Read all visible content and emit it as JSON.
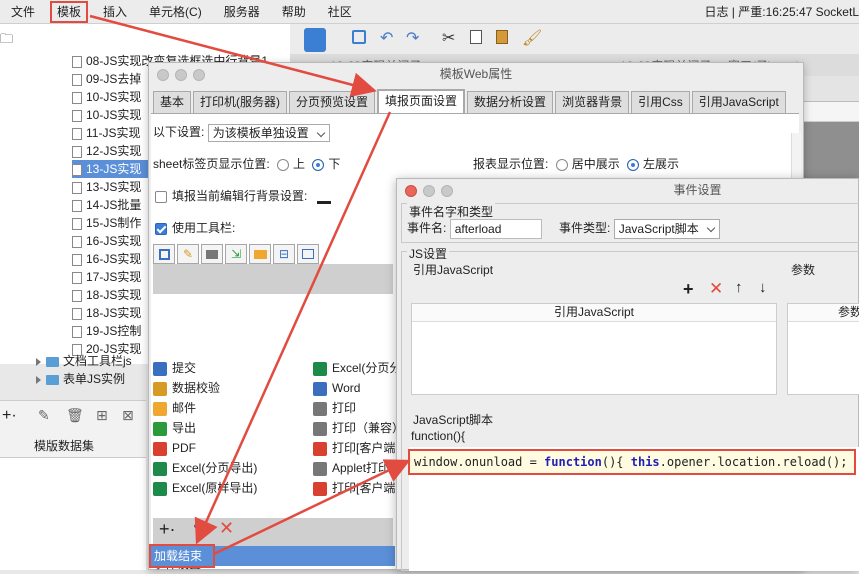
{
  "menubar": {
    "items": [
      "文件",
      "模板",
      "插入",
      "单元格(C)",
      "服务器",
      "帮助",
      "社区"
    ],
    "log": "日志 | 严重:16:25:47 SocketL"
  },
  "tree": {
    "files": [
      "08-JS实现改变复选框选中行背景1",
      "09-JS去掉",
      "10-JS实现",
      "10-JS实现",
      "11-JS实现",
      "12-JS实现",
      "13-JS实现",
      "13-JS实现",
      "14-JS批量",
      "15-JS制作",
      "16-JS实现",
      "16-JS实现",
      "17-JS实现",
      "18-JS实现",
      "18-JS实现",
      "19-JS控制",
      "20-JS实现"
    ],
    "folders": [
      "文档工具栏js",
      "表单JS实例"
    ],
    "bottom_label": "模版数据集"
  },
  "editor_tabs": {
    "tab1": "13-JS实现关闭子 ...",
    "tab2": "12-JS实现关闭子 ... 窗口(子).cpt *",
    "ruler": "500"
  },
  "dialog1": {
    "title": "模板Web属性",
    "tabs": [
      "基本",
      "打印机(服务器)",
      "分页预览设置",
      "填报页面设置",
      "数据分析设置",
      "浏览器背景",
      "引用Css",
      "引用JavaScript"
    ],
    "settings_label": "以下设置:",
    "settings_value": "为该模板单独设置",
    "sheet_label": "sheet标签页显示位置:",
    "sheet_opts": [
      "上",
      "下"
    ],
    "report_label": "报表显示位置:",
    "report_opts": [
      "居中展示",
      "左展示"
    ],
    "bg_label": "填报当前编辑行背景设置:",
    "toolbar_label": "使用工具栏:",
    "toolbar_items_left": [
      "提交",
      "数据校验",
      "邮件",
      "导出",
      "PDF",
      "Excel(分页导出)",
      "Excel(原样导出)"
    ],
    "toolbar_items_right": [
      "Excel(分页分",
      "Word",
      "打印",
      "打印（兼容）",
      "打印[客户端",
      "Applet打印",
      "打印[客户端"
    ],
    "event_label": "事件设置:",
    "event_item": "加载结束"
  },
  "dialog2": {
    "title": "事件设置",
    "group1": "事件名字和类型",
    "event_name_label": "事件名:",
    "event_name_value": "afterload",
    "event_type_label": "事件类型:",
    "event_type_value": "JavaScript脚本",
    "js_group": "JS设置",
    "ref_js_label": "引用JavaScript",
    "params_label": "参数",
    "ref_js_header": "引用JavaScript",
    "params_header": "参数",
    "script_label": "JavaScript脚本",
    "func_open": "function(){",
    "code": {
      "p1": "window.onunload = ",
      "k1": "function",
      "p2": "(){ ",
      "k2": "this",
      "p3": ".opener.location.reload(); }"
    }
  },
  "colors": {
    "accent": "#e24b3f",
    "selection": "#5b8fd8"
  }
}
